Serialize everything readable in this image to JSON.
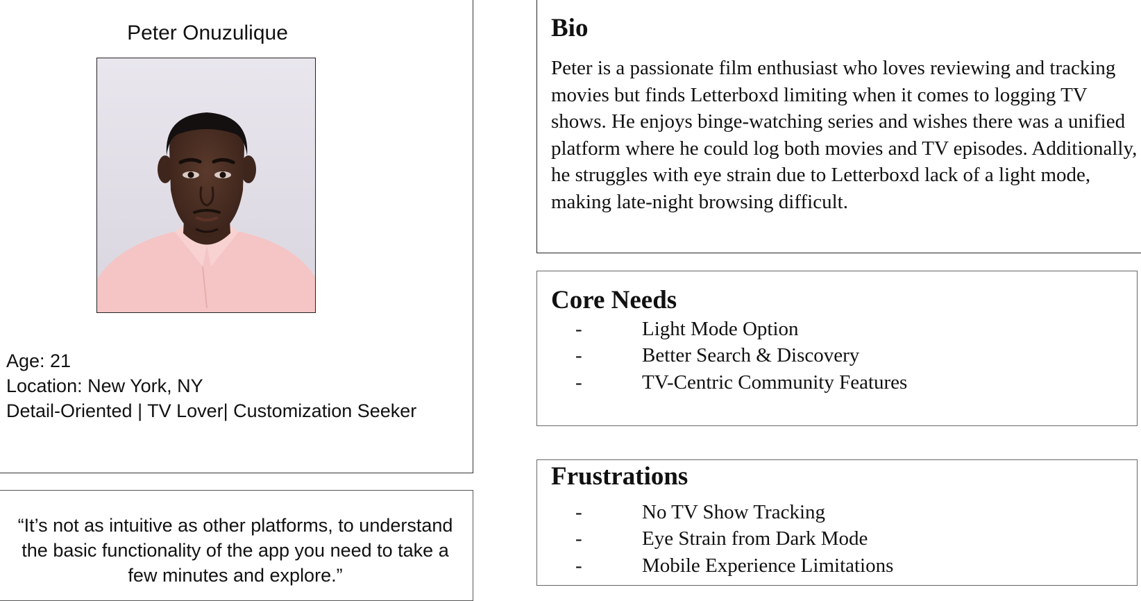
{
  "persona": {
    "name": "Peter Onuzulique",
    "photo_alt": "portrait-photo",
    "age_line": "Age: 21",
    "location_line": "Location: New York,  NY",
    "traits_line": "Detail-Oriented | TV Lover| Customization Seeker"
  },
  "quote": {
    "text": "“It’s not as intuitive as other platforms, to understand the basic functionality of the app you need to take a few minutes and explore.”"
  },
  "bio": {
    "title": "Bio",
    "text": "Peter is a passionate film enthusiast who loves reviewing and tracking movies but finds Letterboxd limiting when it comes to logging TV shows. He enjoys binge-watching series and wishes there was a unified platform where he could log both movies and TV episodes. Additionally, he struggles with eye strain due to Letterboxd lack of a light mode, making late-night browsing difficult."
  },
  "core_needs": {
    "title": "Core Needs",
    "bullet": "-",
    "items": [
      "Light Mode Option",
      "Better Search & Discovery",
      "TV-Centric  Community Features"
    ]
  },
  "frustrations": {
    "title": "Frustrations",
    "bullet": "-",
    "items": [
      "No TV Show Tracking",
      "Eye Strain from Dark Mode",
      "Mobile Experience Limitations"
    ]
  }
}
